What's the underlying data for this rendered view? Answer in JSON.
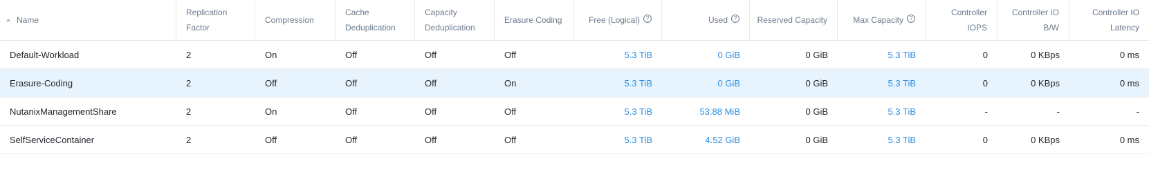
{
  "columns": {
    "name": "Name",
    "replication_factor": "Replication Factor",
    "compression": "Compression",
    "cache_dedup": "Cache Deduplication",
    "capacity_dedup": "Capacity Deduplication",
    "erasure_coding": "Erasure Coding",
    "free_logical": "Free (Logical)",
    "used": "Used",
    "reserved_capacity": "Reserved Capacity",
    "max_capacity": "Max Capacity",
    "controller_iops": "Controller IOPS",
    "controller_io_bw": "Controller IO B/W",
    "controller_io_latency": "Controller IO Latency"
  },
  "icons": {
    "sort": "sort-ascending-icon",
    "help": "question-mark-circle-icon"
  },
  "colors": {
    "link": "#2c8fe4",
    "selected_row": "#e8f4fd"
  },
  "rows": [
    {
      "name": "Default-Workload",
      "replication_factor": "2",
      "compression": "On",
      "cache_dedup": "Off",
      "capacity_dedup": "Off",
      "erasure_coding": "Off",
      "free_logical": "5.3 TiB",
      "used": "0 GiB",
      "reserved_capacity": "0 GiB",
      "max_capacity": "5.3 TiB",
      "controller_iops": "0",
      "controller_io_bw": "0 KBps",
      "controller_io_latency": "0 ms"
    },
    {
      "name": "Erasure-Coding",
      "replication_factor": "2",
      "compression": "Off",
      "cache_dedup": "Off",
      "capacity_dedup": "Off",
      "erasure_coding": "On",
      "free_logical": "5.3 TiB",
      "used": "0 GiB",
      "reserved_capacity": "0 GiB",
      "max_capacity": "5.3 TiB",
      "controller_iops": "0",
      "controller_io_bw": "0 KBps",
      "controller_io_latency": "0 ms"
    },
    {
      "name": "NutanixManagementShare",
      "replication_factor": "2",
      "compression": "On",
      "cache_dedup": "Off",
      "capacity_dedup": "Off",
      "erasure_coding": "Off",
      "free_logical": "5.3 TiB",
      "used": "53.88 MiB",
      "reserved_capacity": "0 GiB",
      "max_capacity": "5.3 TiB",
      "controller_iops": "-",
      "controller_io_bw": "-",
      "controller_io_latency": "-"
    },
    {
      "name": "SelfServiceContainer",
      "replication_factor": "2",
      "compression": "Off",
      "cache_dedup": "Off",
      "capacity_dedup": "Off",
      "erasure_coding": "Off",
      "free_logical": "5.3 TiB",
      "used": "4.52 GiB",
      "reserved_capacity": "0 GiB",
      "max_capacity": "5.3 TiB",
      "controller_iops": "0",
      "controller_io_bw": "0 KBps",
      "controller_io_latency": "0 ms"
    }
  ]
}
